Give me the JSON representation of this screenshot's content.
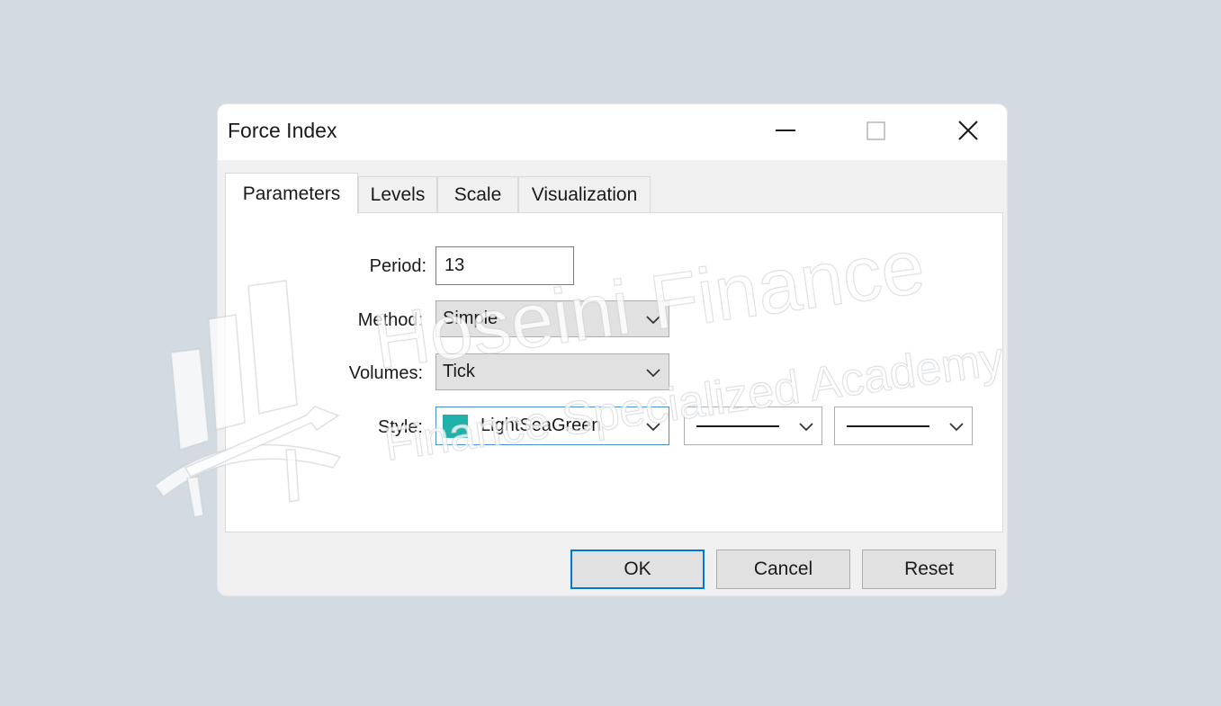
{
  "window": {
    "title": "Force Index",
    "minimize_icon": "minimize-icon",
    "maximize_icon": "maximize-icon",
    "close_icon": "close-icon"
  },
  "tabs": [
    {
      "label": "Parameters",
      "active": true
    },
    {
      "label": "Levels",
      "active": false
    },
    {
      "label": "Scale",
      "active": false
    },
    {
      "label": "Visualization",
      "active": false
    }
  ],
  "form": {
    "period_label": "Period:",
    "period_value": "13",
    "method_label": "Method:",
    "method_value": "Simple",
    "volumes_label": "Volumes:",
    "volumes_value": "Tick",
    "style_label": "Style:",
    "style_color_name": "LightSeaGreen",
    "style_color_hex": "#20b2aa",
    "line_width_icon": "line-width-icon",
    "line_style_icon": "line-style-icon"
  },
  "buttons": {
    "ok": "OK",
    "cancel": "Cancel",
    "reset": "Reset"
  },
  "watermark": {
    "line1": "Hoseini Finance",
    "line2": "Finance Specialized Academy",
    "logo_icon": "building-logo-icon"
  },
  "colors": {
    "background": "#d3dbe2",
    "accent": "#0078d7",
    "swatch": "#20b2aa"
  }
}
